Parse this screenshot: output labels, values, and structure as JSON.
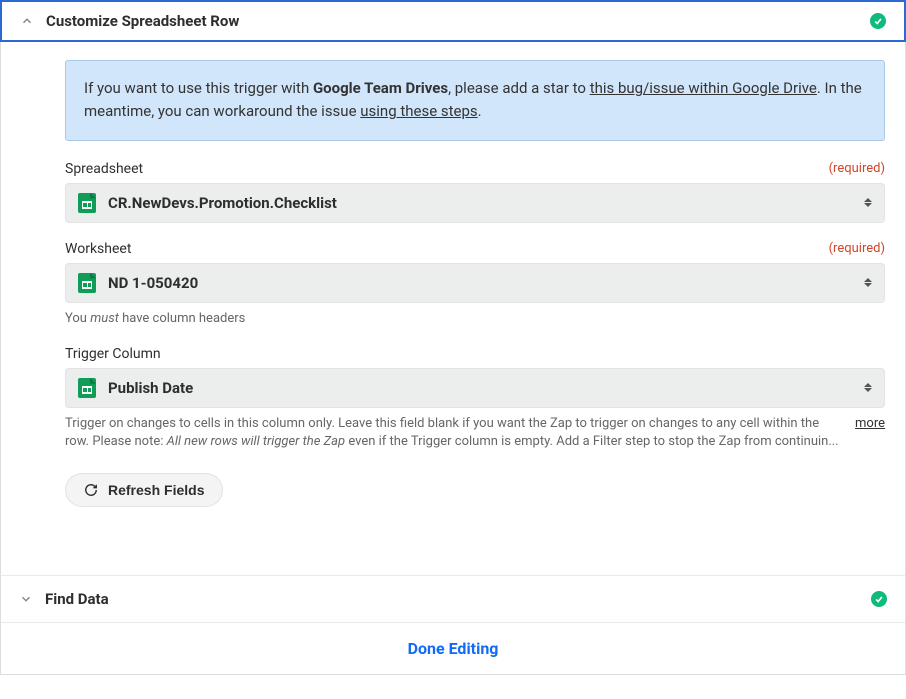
{
  "panel1": {
    "title": "Customize Spreadsheet Row"
  },
  "info": {
    "prefix": "If you want to use this trigger with ",
    "bold": "Google Team Drives",
    "mid": ", please add a star to ",
    "link1": "this bug/issue within Google Drive",
    "mid2": ". In the meantime, you can workaround the issue ",
    "link2": "using these steps",
    "suffix": "."
  },
  "fields": {
    "spreadsheet": {
      "label": "Spreadsheet",
      "required": "(required)",
      "value": "CR.NewDevs.Promotion.Checklist"
    },
    "worksheet": {
      "label": "Worksheet",
      "required": "(required)",
      "value": "ND 1-050420",
      "helper_pre": "You ",
      "helper_em": "must",
      "helper_post": " have column headers"
    },
    "trigger_column": {
      "label": "Trigger Column",
      "value": "Publish Date",
      "helper_pre": "Trigger on changes to cells in this column only. Leave this field blank if you want the Zap to trigger on changes to any cell within the row. Please note: ",
      "helper_em": "All new rows will trigger the Zap",
      "helper_post": " even if the Trigger column is empty. Add a Filter step to stop the Zap from continuin...",
      "more": "more"
    }
  },
  "buttons": {
    "refresh": "Refresh Fields",
    "done": "Done Editing"
  },
  "panel2": {
    "title": "Find Data"
  }
}
